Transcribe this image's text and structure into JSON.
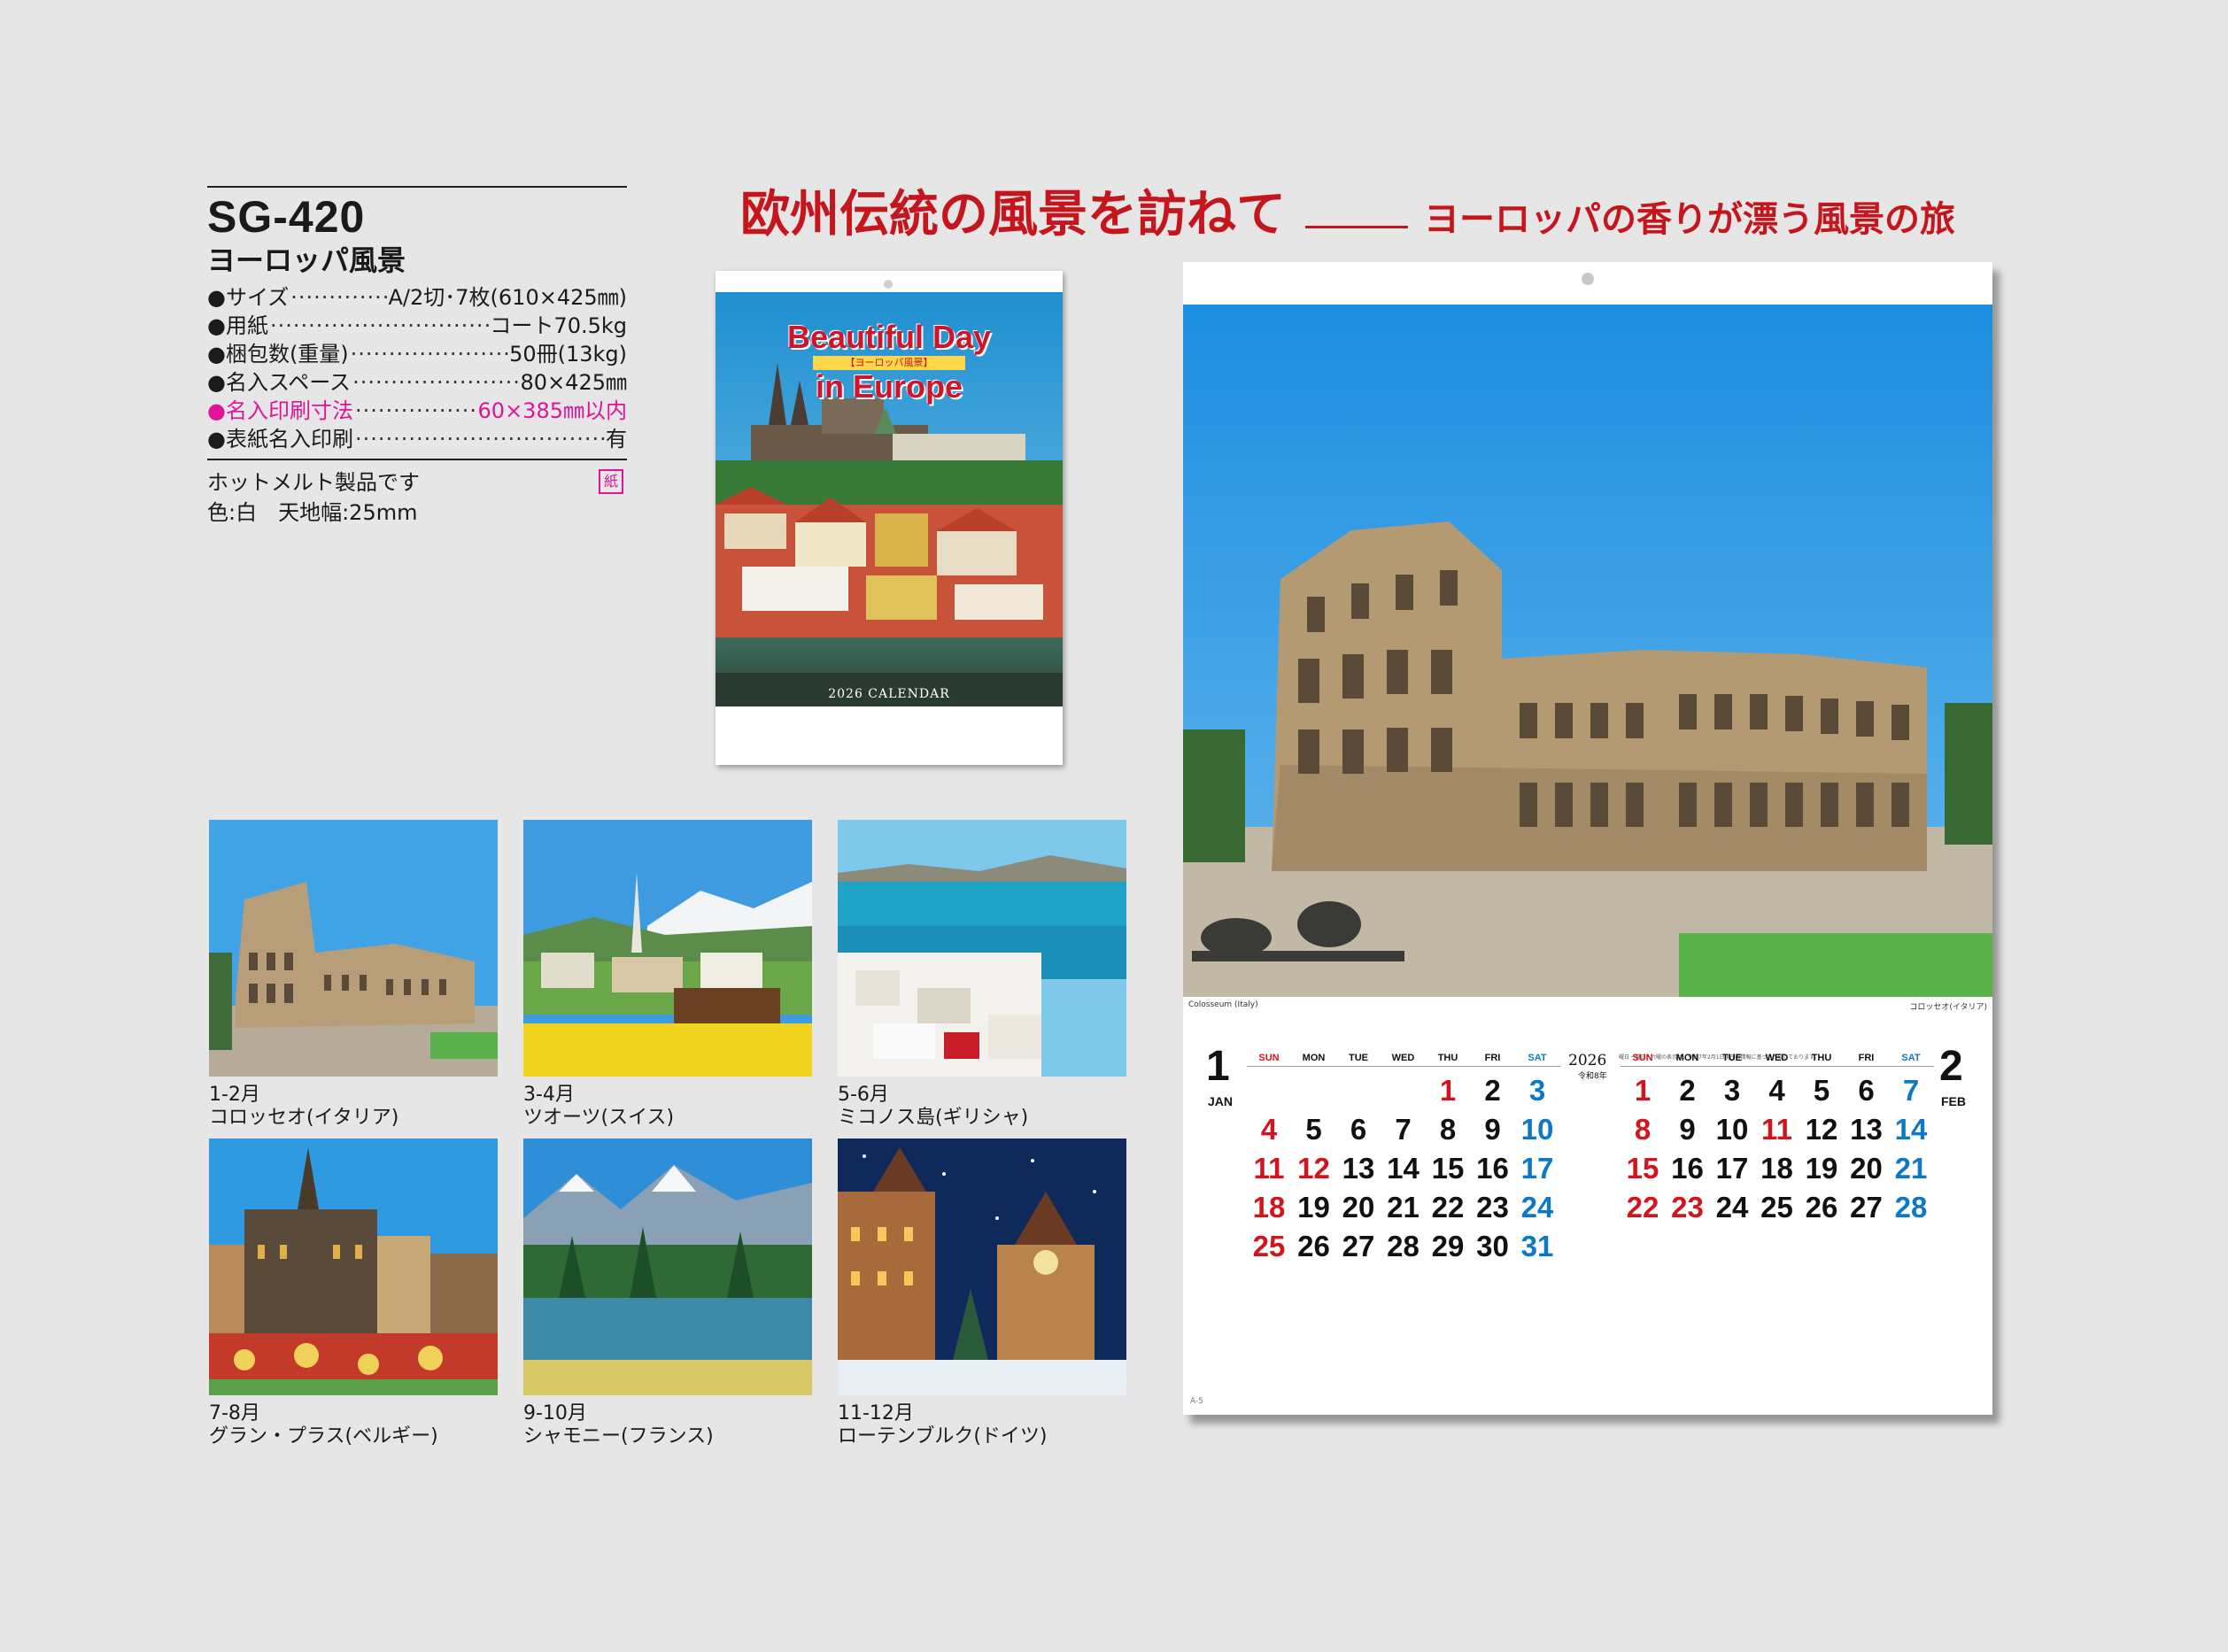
{
  "spec": {
    "code": "SG-420",
    "name": "ヨーロッパ風景",
    "rows": [
      {
        "label": "●サイズ",
        "value": "A/2切･7枚(610×425㎜)"
      },
      {
        "label": "●用紙",
        "value": "コート70.5kg"
      },
      {
        "label": "●梱包数(重量)",
        "value": "50冊(13kg)"
      },
      {
        "label": "●名入スペース",
        "value": "80×425㎜"
      },
      {
        "label": "●名入印刷寸法",
        "value": "60×385㎜以内"
      },
      {
        "label": "●表紙名入印刷",
        "value": "有"
      }
    ],
    "note1": "ホットメルト製品です",
    "note2": "色:白　天地幅:25mm",
    "paper_mark": "紙",
    "highlight_color": "#e0149a"
  },
  "headline": {
    "main": "欧州伝統の風景を訪ねて",
    "sub": "ヨーロッパの香りが漂う風景の旅",
    "color": "#c4161c"
  },
  "cover": {
    "title_line1": "Beautiful Day",
    "title_line2": "in Europe",
    "ribbon": "【ヨーロッパ風景】",
    "calendar_label": "2026 CALENDAR"
  },
  "thumbnails": [
    {
      "months": "1-2月",
      "place": "コロッセオ(イタリア)",
      "scene": "colosseum-icon"
    },
    {
      "months": "3-4月",
      "place": "ツオーツ(スイス)",
      "scene": "alpine-village-icon"
    },
    {
      "months": "5-6月",
      "place": "ミコノス島(ギリシャ)",
      "scene": "seaside-town-icon"
    },
    {
      "months": "7-8月",
      "place": "グラン・プラス(ベルギー)",
      "scene": "town-square-icon"
    },
    {
      "months": "9-10月",
      "place": "シャモニー(フランス)",
      "scene": "mountain-lake-icon"
    },
    {
      "months": "11-12月",
      "place": "ローテンブルク(ドイツ)",
      "scene": "christmas-town-icon"
    }
  ],
  "calendar": {
    "photo_caption_left": "Colosseum (Italy)",
    "photo_caption_right": "コロッセオ(イタリア)",
    "year": "2026",
    "era": "令和8年",
    "notes": "曜日・祝日・六曜の表示は、令和7年2月1日現在の情報に基づき作成しております。",
    "footer": "A-5",
    "weekdays": [
      "SUN",
      "MON",
      "TUE",
      "WED",
      "THU",
      "FRI",
      "SAT"
    ],
    "months": [
      {
        "num": "1",
        "abbr": "JAN",
        "start": 4,
        "days": 31,
        "holidays": [
          1,
          12
        ]
      },
      {
        "num": "2",
        "abbr": "FEB",
        "start": 0,
        "days": 28,
        "holidays": [
          11,
          23
        ]
      }
    ],
    "colors": {
      "holiday": "#d2141c",
      "saturday": "#0d78c8",
      "weekday": "#111111"
    }
  }
}
